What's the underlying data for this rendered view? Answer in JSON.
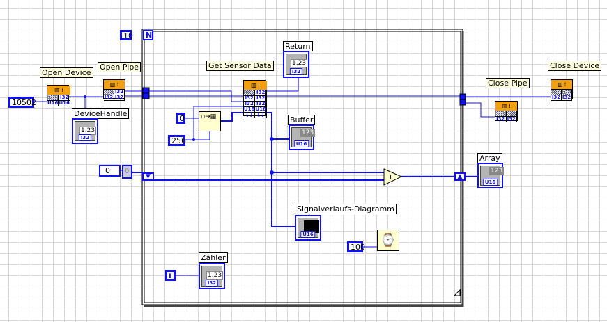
{
  "loop": {
    "count": "10",
    "count_terminal": "N",
    "iteration_terminal": "i"
  },
  "open_device": {
    "label": "Open Device",
    "input": "10502",
    "terminals": [
      "",
      "I32",
      "U16",
      "U16"
    ]
  },
  "open_pipe": {
    "label": "Open Pipe",
    "terminals": [
      "",
      "I32",
      "I32",
      "I32"
    ]
  },
  "get_sensor": {
    "label": "Get Sensor Data",
    "terminals": [
      "",
      "I32",
      "I32",
      "I32",
      "I32",
      "I32",
      "U16",
      "U16",
      "[ ]",
      "[ ]"
    ]
  },
  "close_pipe": {
    "label": "Close Pipe",
    "terminals": [
      "",
      "",
      "I32",
      "I32"
    ]
  },
  "close_device": {
    "label": "Close Device",
    "terminals": [
      "",
      "",
      "I32",
      "I32"
    ]
  },
  "device_handle": {
    "label": "DeviceHandle",
    "value": "1.23",
    "type": "I32"
  },
  "return_ind": {
    "label": "Return",
    "value": "1.23",
    "type": "I32"
  },
  "buffer": {
    "label": "Buffer",
    "value": "123",
    "type": "U16"
  },
  "array_ind": {
    "label": "Array",
    "value": "123",
    "type": "U16"
  },
  "graph": {
    "label": "Signalverlaufs-Diagramm",
    "type": "U16"
  },
  "counter": {
    "label": "Zähler",
    "value": "1.23",
    "type": "I32"
  },
  "init_array": {
    "element": "0",
    "size": "256"
  },
  "shift_init": {
    "index": "0",
    "value": "0"
  },
  "add": {
    "symbol": "+"
  },
  "wait": {
    "ms": "100"
  },
  "colors": {
    "wire": "#1010f0",
    "node_top": "#f0a010",
    "label_bg": "#ffffe0"
  }
}
